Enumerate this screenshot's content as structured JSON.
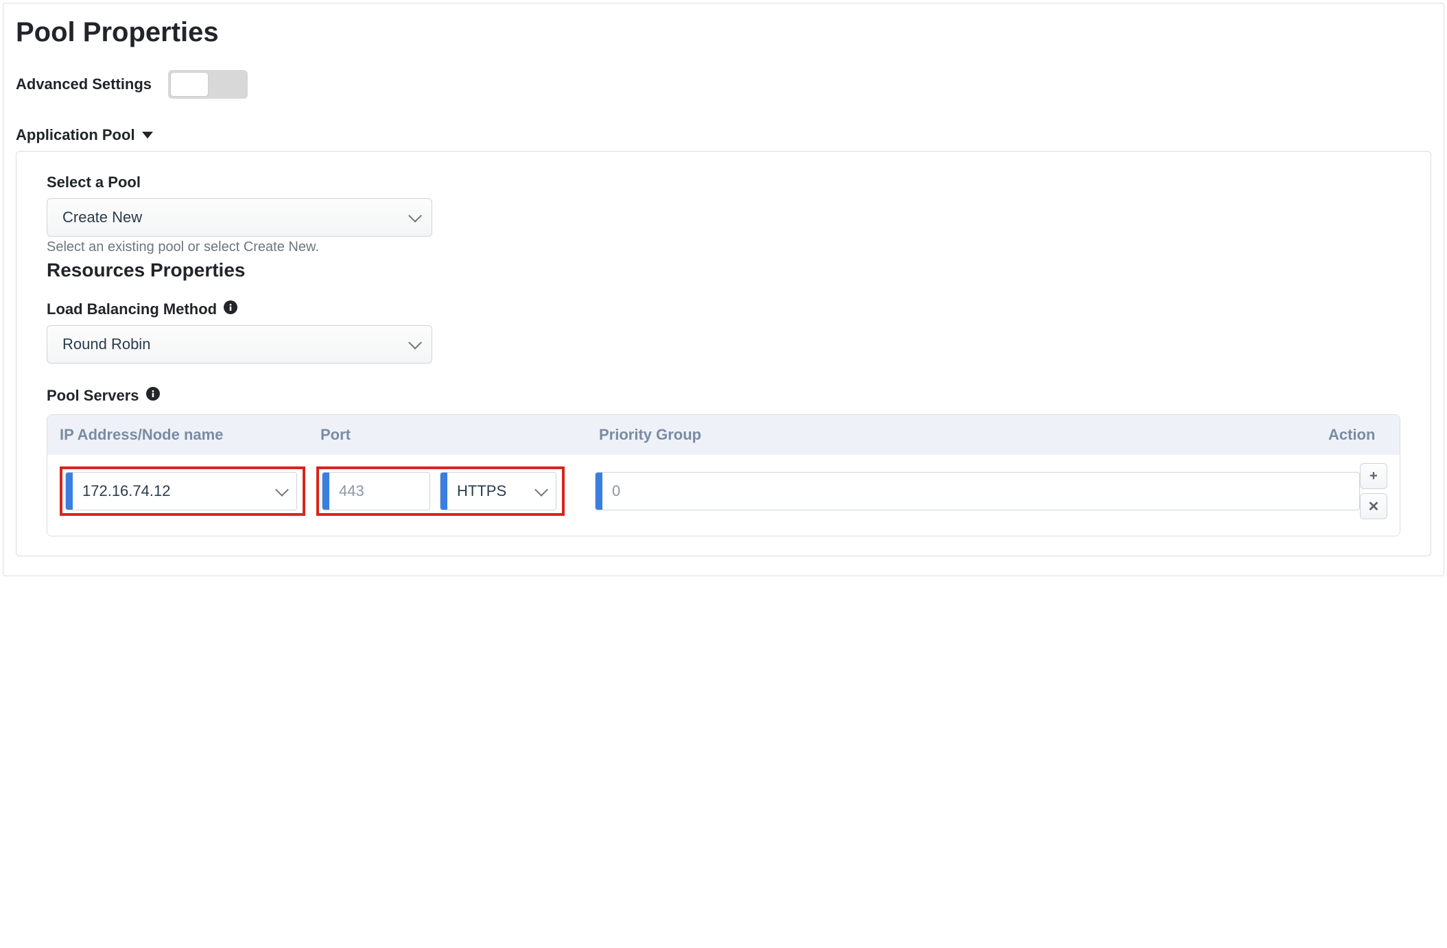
{
  "page": {
    "title": "Pool Properties",
    "advanced_settings_label": "Advanced Settings",
    "advanced_on": false
  },
  "section": {
    "title": "Application Pool"
  },
  "select_pool": {
    "label": "Select a Pool",
    "value": "Create New",
    "help": "Select an existing pool or select Create New."
  },
  "resources": {
    "title": "Resources Properties",
    "lb_label": "Load Balancing Method",
    "lb_value": "Round Robin"
  },
  "pool_servers": {
    "label": "Pool Servers",
    "cols": {
      "ip": "IP Address/Node name",
      "port": "Port",
      "prio": "Priority Group",
      "action": "Action"
    },
    "row": {
      "ip": "172.16.74.12",
      "port": "443",
      "proto": "HTTPS",
      "prio": "0"
    }
  }
}
